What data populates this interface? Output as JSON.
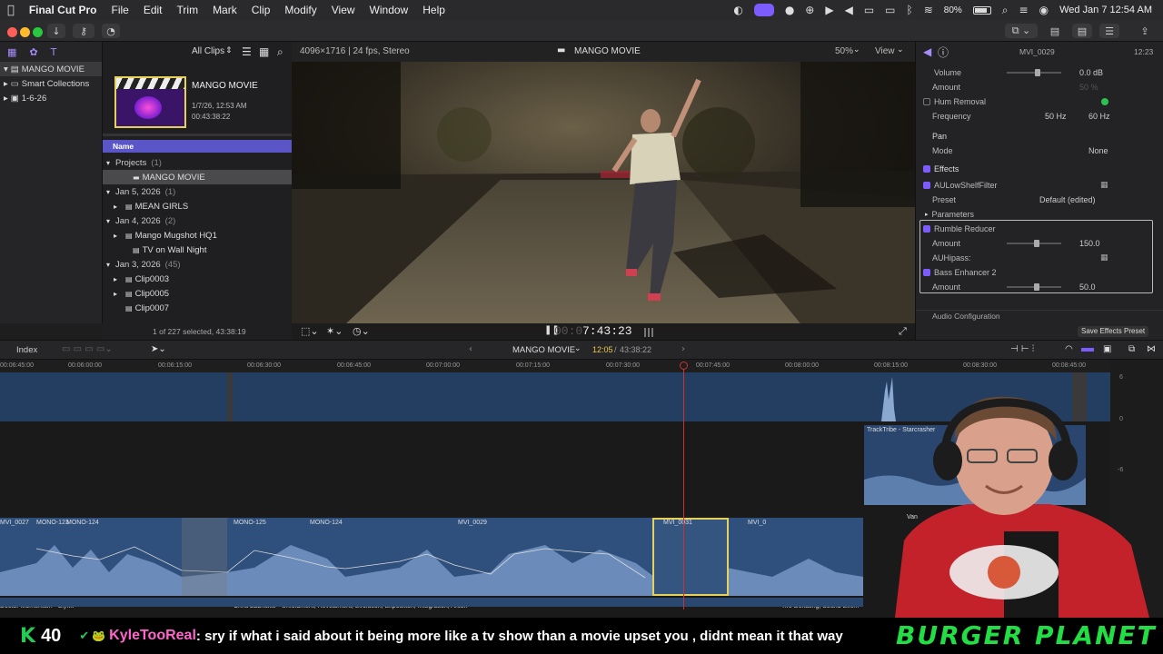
{
  "menubar": {
    "apple": "",
    "app": "Final Cut Pro",
    "items": [
      "File",
      "Edit",
      "Trim",
      "Mark",
      "Clip",
      "Modify",
      "View",
      "Window",
      "Help"
    ],
    "battery": "80%",
    "datetime": "Wed Jan 7  12:54 AM"
  },
  "libraries": {
    "root": "MANGO MOVIE",
    "items": [
      {
        "label": "Smart Collections"
      },
      {
        "label": "1-6-26"
      }
    ]
  },
  "browser": {
    "filter": "All Clips",
    "thumb_title": "MANGO MOVIE",
    "thumb_date": "1/7/26, 12:53 AM",
    "thumb_duration": "00:43:38:22",
    "column_name": "Name",
    "rows": [
      {
        "label": "Projects",
        "count": "(1)",
        "type": "group",
        "indent": 0
      },
      {
        "label": "MANGO MOVIE",
        "count": "",
        "type": "project",
        "indent": 2,
        "selected": true
      },
      {
        "label": "Jan 5, 2026",
        "count": "(1)",
        "type": "group",
        "indent": 0
      },
      {
        "label": "MEAN GIRLS",
        "count": "",
        "type": "event",
        "indent": 1
      },
      {
        "label": "Jan 4, 2026",
        "count": "(2)",
        "type": "group",
        "indent": 0
      },
      {
        "label": "Mango Mugshot HQ1",
        "count": "",
        "type": "event",
        "indent": 1
      },
      {
        "label": "TV on Wall Night",
        "count": "",
        "type": "clip",
        "indent": 2
      },
      {
        "label": "Jan 3, 2026",
        "count": "(45)",
        "type": "group",
        "indent": 0
      },
      {
        "label": "Clip0003",
        "count": "",
        "type": "event",
        "indent": 1
      },
      {
        "label": "Clip0005",
        "count": "",
        "type": "event",
        "indent": 1
      },
      {
        "label": "Clip0007",
        "count": "",
        "type": "clip",
        "indent": 1
      }
    ],
    "status": "1 of 227 selected, 43:38:19"
  },
  "viewer": {
    "format": "4096×1716 | 24 fps, Stereo",
    "title": "MANGO MOVIE",
    "zoom": "50%",
    "view": "View",
    "timecode_dim": "00:0",
    "timecode": "7:43:23"
  },
  "inspector": {
    "clip": "MVI_0029",
    "duration": "12:23",
    "rows": [
      {
        "label": "Volume",
        "value": "0.0 dB",
        "type": "slider",
        "pos": 0.57
      },
      {
        "label": "Amount",
        "value": "50 %",
        "type": "dim"
      },
      {
        "label": "Hum Removal",
        "value": "",
        "type": "check",
        "checked": false
      },
      {
        "label": "Frequency",
        "value": "50 Hz",
        "value2": "60 Hz",
        "type": "freq"
      },
      {
        "label": "Pan",
        "value": "",
        "type": "section"
      },
      {
        "label": "Mode",
        "value": "None",
        "type": "select"
      },
      {
        "label": "Effects",
        "value": "",
        "type": "fx"
      },
      {
        "label": "AULowShelfFilter",
        "value": "",
        "type": "fxitem"
      },
      {
        "label": "Preset",
        "value": "Default (edited)",
        "type": "select"
      },
      {
        "label": "Parameters",
        "value": "",
        "type": "disclose"
      },
      {
        "label": "Rumble Reducer",
        "value": "",
        "type": "fxitem"
      },
      {
        "label": "Amount",
        "value": "150.0",
        "type": "slider",
        "pos": 0.55
      },
      {
        "label": "AUHipass:",
        "value": "",
        "type": "plain"
      },
      {
        "label": "Bass Enhancer 2",
        "value": "",
        "type": "fxitem"
      },
      {
        "label": "Amount",
        "value": "50.0",
        "type": "slider",
        "pos": 0.55
      }
    ],
    "audio_config": "Audio Configuration",
    "save_preset": "Save Effects Preset"
  },
  "timeline": {
    "index": "Index",
    "project": "MANGO MOVIE",
    "position": "12:05",
    "total": "43:38:22",
    "ruler": [
      "00:06:45:00",
      "00:06:00:00",
      "00:06:15:00",
      "00:06:30:00",
      "00:06:45:00",
      "00:07:00:00",
      "00:07:15:00",
      "00:07:30:00",
      "00:07:45:00",
      "00:08:00:00",
      "00:08:15:00",
      "00:08:30:00",
      "00:08:45:00"
    ],
    "music": "TrackTribe - Starcrasher",
    "clips": [
      "MVI_0027",
      "MONO-123",
      "MONO-124",
      "MONO-125",
      "MONO-124",
      "MVI_0029",
      "MVI_0031",
      "MVI_0"
    ],
    "audio_labels": [
      "Doctor Momentum - Slynk",
      "Chris Zabriskie - Unfoldment, Revealment, Evolution, Exposition, Integration, Arson",
      "Tire Deflating, Sound Effe...",
      "Van"
    ],
    "meters": [
      "6",
      "0",
      "-6"
    ]
  },
  "chat": {
    "count": "40",
    "username": "KyleTooReal",
    "message": ": sry if what i said about it being more like a tv show than a movie upset you , didnt mean it that way",
    "brand": "BURGER PLANET"
  }
}
